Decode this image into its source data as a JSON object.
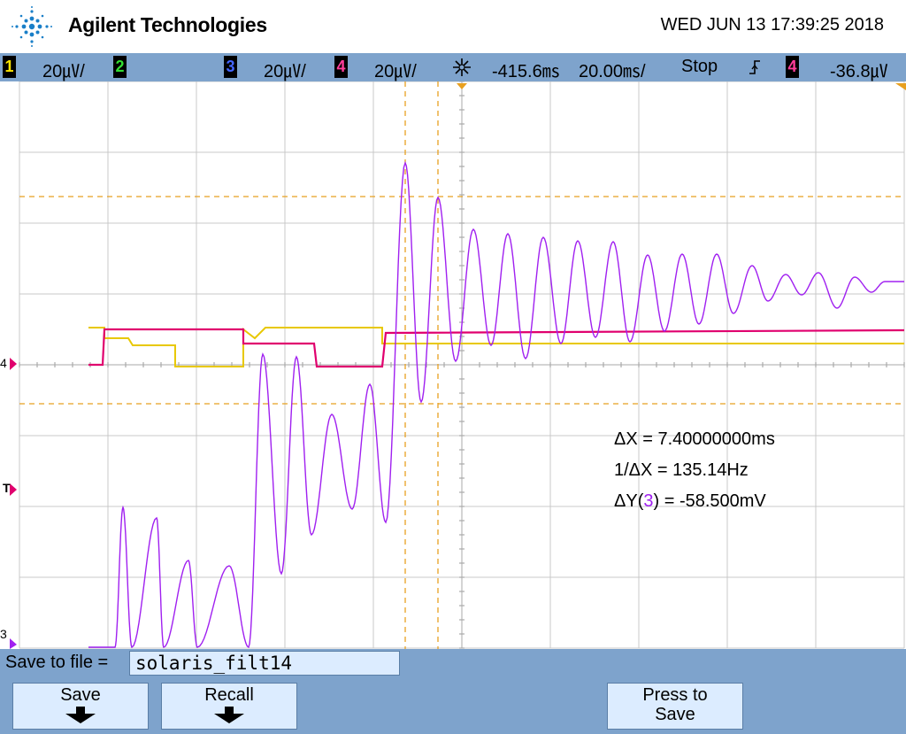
{
  "header": {
    "brand": "Agilent Technologies",
    "datetime": "WED JUN 13 17:39:25 2018",
    "logo_icon": "agilent-spark-logo-icon"
  },
  "status_bar": {
    "ch1": {
      "number": "1",
      "scale": "20㎶/",
      "color": "#ffe600"
    },
    "ch2": {
      "number": "2",
      "color": "#33dd33"
    },
    "ch3": {
      "number": "3",
      "scale": "20㎶/",
      "color": "#3355ff"
    },
    "ch4": {
      "number": "4",
      "scale": "20㎶/",
      "color": "#ff3d9a"
    },
    "time_delay": "-415.6㎳",
    "time_scale": "20.00㎳/",
    "run_state": "Stop",
    "trigger_channel": "4",
    "trigger_level": "-36.8㎶",
    "trigger_icon": "trigger-edge-icon",
    "delay_icon": "delay-star-icon"
  },
  "screen": {
    "markers": {
      "ch4": "4",
      "trigger": "T",
      "ch3": "3"
    },
    "colors": {
      "ch1": "#e8c800",
      "ch3": "#a020f0",
      "ch4": "#e0006e",
      "cursor": "#e8a020",
      "grid": "#c8c8c8"
    },
    "measurements": {
      "delta_x": "ΔX = 7.40000000ms",
      "inv_delta_x": "1/ΔX = 135.14Hz",
      "delta_y_prefix": "ΔY(",
      "delta_y_channel": "3",
      "delta_y_suffix": ") = -58.500mV"
    }
  },
  "softkeys": {
    "save_to_file_label": "Save to file =",
    "filename": "solaris_filt14",
    "save": "Save",
    "recall": "Recall",
    "press_to_save_line1": "Press to",
    "press_to_save_line2": "Save"
  }
}
